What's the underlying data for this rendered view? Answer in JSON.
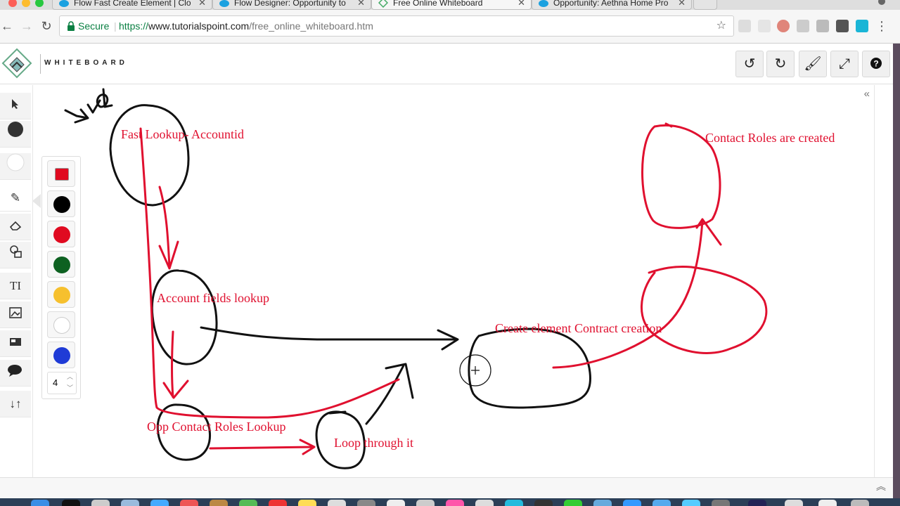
{
  "browser": {
    "tabs": [
      {
        "label": "Flow Fast Create Element | Clo",
        "icon": "salesforce-cloud-icon",
        "active": false
      },
      {
        "label": "Flow Designer: Opportunity to",
        "icon": "salesforce-cloud-icon",
        "active": false
      },
      {
        "label": "Free Online Whiteboard",
        "icon": "tutorialspoint-icon",
        "active": true
      },
      {
        "label": "Opportunity: Aethna Home Pro",
        "icon": "salesforce-cloud-icon",
        "active": false
      }
    ],
    "secure_label": "Secure",
    "url_scheme": "https://",
    "url_host": "www.tutorialspoint.com",
    "url_path": "/free_online_whiteboard.htm"
  },
  "app": {
    "title": "WHITEBOARD",
    "header_buttons": [
      "undo-icon",
      "redo-icon",
      "brush-icon",
      "fullscreen-icon",
      "help-icon"
    ]
  },
  "tools": [
    "select-arrow-icon",
    "filled-circle-icon",
    "empty-circle-icon",
    "pencil-icon",
    "eraser-icon",
    "shapes-icon",
    "text-icon",
    "image-icon",
    "screen-icon",
    "comment-icon",
    "sort-arrows-icon"
  ],
  "palette": {
    "colors": [
      "#e00a20",
      "#000000",
      "#e00a20",
      "#0d6121",
      "#f6c02e",
      "#ffffff",
      "#1f3bd6"
    ],
    "stroke_width": "4"
  },
  "drawing": {
    "labels": {
      "fast_lookup": "Fast Lookup- Accountid",
      "account_fields": "Account fields lookup",
      "opp_contact": "Opp Contact Roles Lookup",
      "loop": "Loop through it",
      "create_element": "Create element Contract creation",
      "contact_roles": "Contact Roles are created"
    },
    "ink_colors": {
      "red": "#e0102f",
      "black": "#111111"
    }
  }
}
